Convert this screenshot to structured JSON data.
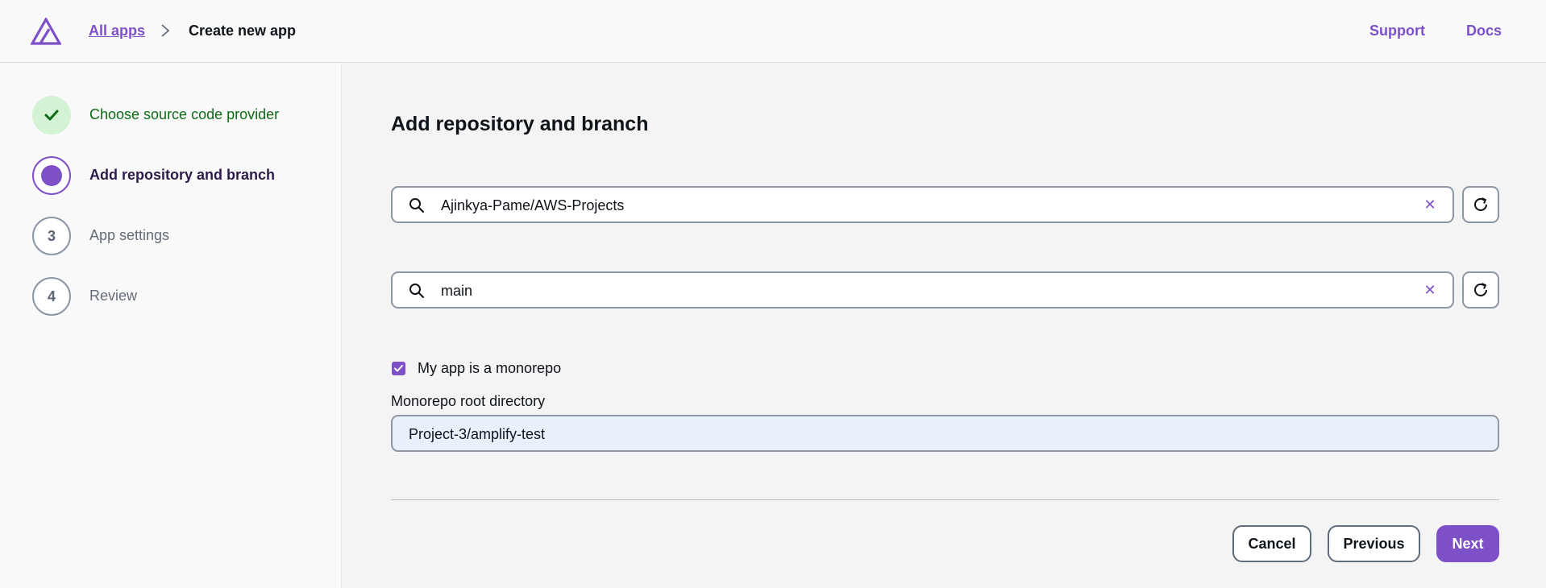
{
  "header": {
    "breadcrumb_link": "All apps",
    "breadcrumb_current": "Create new app",
    "support_link": "Support",
    "docs_link": "Docs",
    "brand_color": "#7e50c7"
  },
  "steps": [
    {
      "label": "Choose source code provider",
      "state": "complete",
      "icon": "check-icon"
    },
    {
      "label": "Add repository and branch",
      "state": "current"
    },
    {
      "number": "3",
      "label": "App settings",
      "state": "pending"
    },
    {
      "number": "4",
      "label": "Review",
      "state": "pending"
    }
  ],
  "main": {
    "title": "Add repository and branch",
    "repository_value": "Ajinkya-Pame/AWS-Projects",
    "branch_value": "main",
    "monorepo_checkbox_label": "My app is a monorepo",
    "monorepo_checked": true,
    "monorepo_root_label": "Monorepo root directory",
    "monorepo_root_value": "Project-3/amplify-test"
  },
  "actions": {
    "cancel": "Cancel",
    "previous": "Previous",
    "next": "Next"
  }
}
